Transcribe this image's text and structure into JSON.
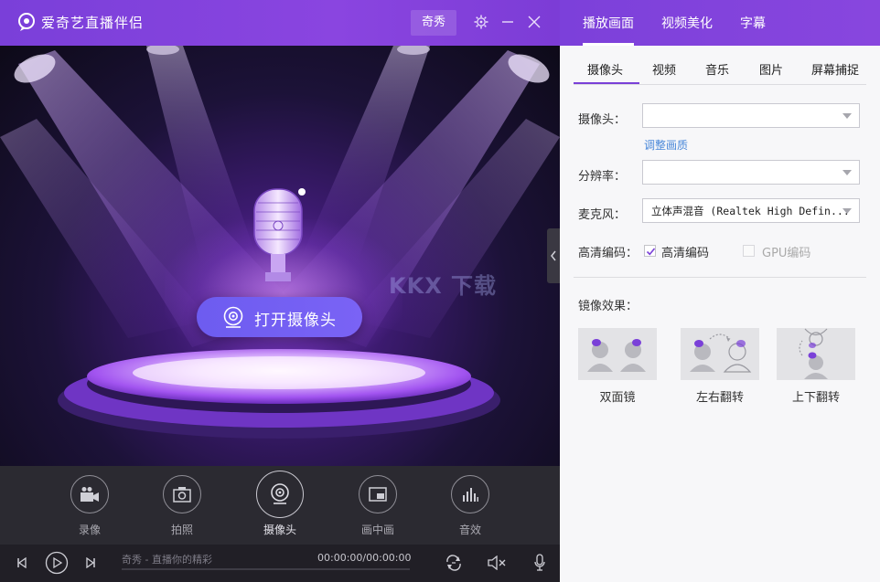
{
  "app": {
    "title": "爱奇艺直播伴侣",
    "qixiu_button": "奇秀"
  },
  "stage": {
    "open_camera_label": "打开摄像头",
    "watermark": "KKX 下载"
  },
  "tools": [
    {
      "id": "record",
      "label": "录像",
      "icon": "video-camera-icon"
    },
    {
      "id": "photo",
      "label": "拍照",
      "icon": "photo-camera-icon"
    },
    {
      "id": "camera",
      "label": "摄像头",
      "icon": "webcam-icon",
      "active": true
    },
    {
      "id": "pip",
      "label": "画中画",
      "icon": "picture-in-picture-icon"
    },
    {
      "id": "sfx",
      "label": "音效",
      "icon": "equalizer-icon"
    }
  ],
  "player": {
    "status": "奇秀 - 直播你的精彩",
    "time": "00:00:00/00:00:00"
  },
  "right_tabs": [
    {
      "label": "播放画面",
      "active": true
    },
    {
      "label": "视频美化"
    },
    {
      "label": "字幕"
    }
  ],
  "sub_tabs": [
    {
      "label": "摄像头",
      "active": true
    },
    {
      "label": "视频"
    },
    {
      "label": "音乐"
    },
    {
      "label": "图片"
    },
    {
      "label": "屏幕捕捉"
    }
  ],
  "form": {
    "camera_label": "摄像头：",
    "camera_value": "",
    "adjust_link": "调整画质",
    "resolution_label": "分辨率：",
    "resolution_value": "",
    "mic_label": "麦克风：",
    "mic_value": "立体声混音 (Realtek High Defin...",
    "hd_label": "高清编码：",
    "hd_checkbox_label": "高清编码",
    "hd_checked": true,
    "gpu_checkbox_label": "GPU编码",
    "gpu_checked": false
  },
  "mirror": {
    "title": "镜像效果：",
    "options": [
      {
        "label": "双面镜",
        "icon": "dual-mirror-icon"
      },
      {
        "label": "左右翻转",
        "icon": "flip-horizontal-icon"
      },
      {
        "label": "上下翻转",
        "icon": "flip-vertical-icon"
      }
    ]
  },
  "colors": {
    "accent": "#7c40da",
    "button": "#7063f3",
    "link": "#4a88d9"
  }
}
